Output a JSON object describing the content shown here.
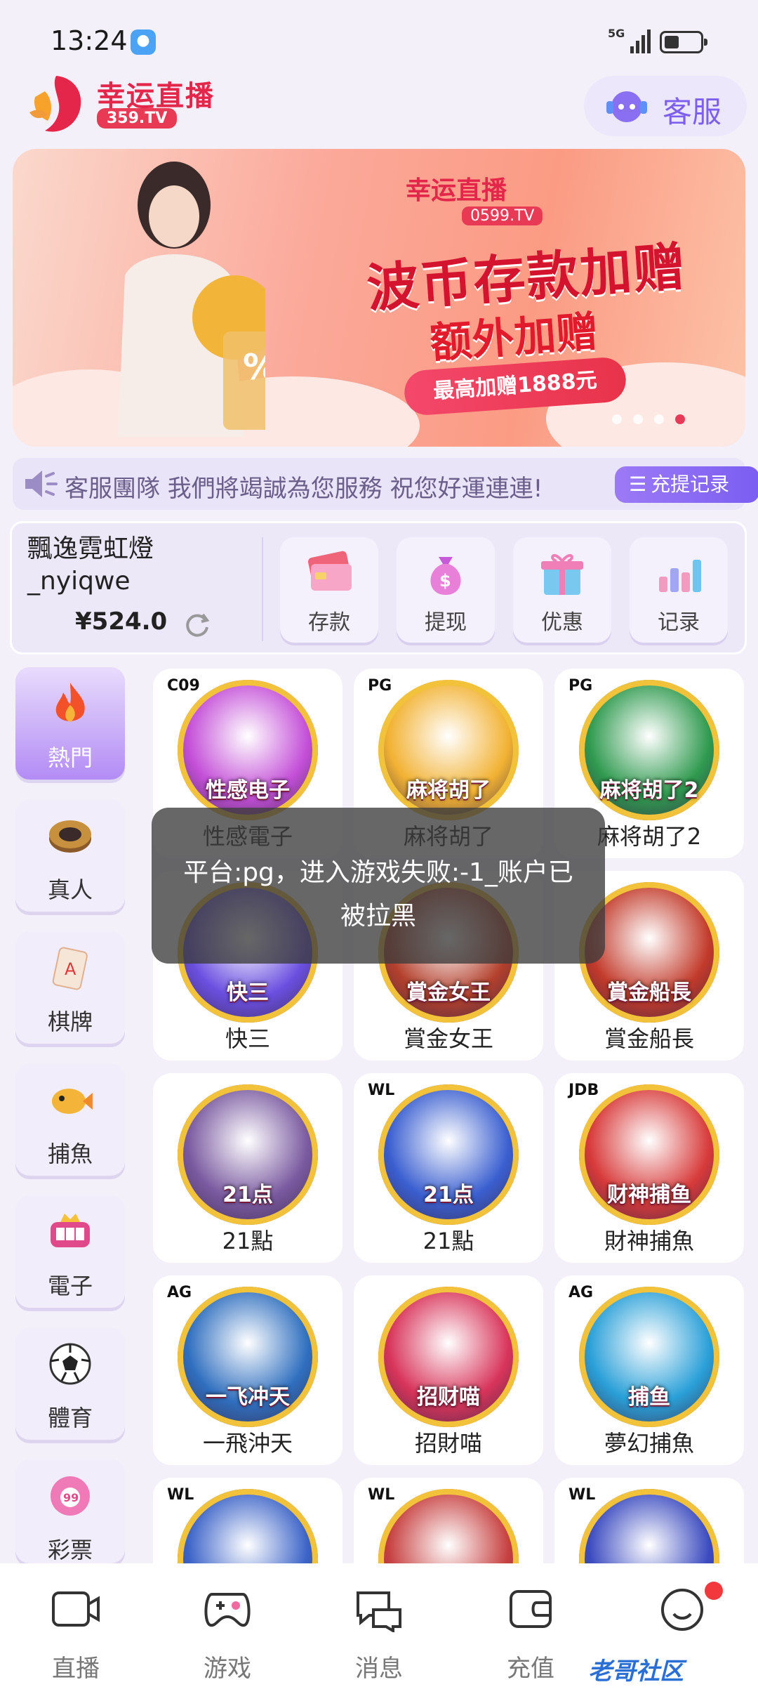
{
  "status_bar": {
    "time": "13:24",
    "network": "5G"
  },
  "header": {
    "app_name": "幸运直播",
    "domain": "359.TV",
    "service_label": "客服"
  },
  "banner": {
    "brand": "幸运直播",
    "brand_domain": "0599.TV",
    "headline": "波币存款加赠",
    "subline": "额外加赠",
    "pill": "最高加赠1888元",
    "badge_text": "%",
    "slide_count": 4,
    "active_slide": 4
  },
  "notice": {
    "text": "客服團隊 我們將竭誠為您服務 祝您好運連連!",
    "record_button": "充提记录"
  },
  "account": {
    "username": "飄逸霓虹燈_nyiqwe",
    "balance": "¥524.0",
    "actions": [
      {
        "label": "存款",
        "icon": "card-icon"
      },
      {
        "label": "提现",
        "icon": "money-bag-icon"
      },
      {
        "label": "优惠",
        "icon": "gift-icon"
      },
      {
        "label": "记录",
        "icon": "bar-chart-icon"
      }
    ]
  },
  "categories": [
    {
      "label": "熱門",
      "icon": "flame-icon",
      "active": true
    },
    {
      "label": "真人",
      "icon": "chip-icon",
      "active": false
    },
    {
      "label": "棋牌",
      "icon": "playing-card-icon",
      "active": false
    },
    {
      "label": "捕魚",
      "icon": "fish-icon",
      "active": false
    },
    {
      "label": "電子",
      "icon": "slot-machine-icon",
      "active": false
    },
    {
      "label": "體育",
      "icon": "soccer-ball-icon",
      "active": false
    },
    {
      "label": "彩票",
      "icon": "lottery-ball-icon",
      "active": false
    }
  ],
  "games": [
    {
      "title": "性感電子",
      "provider": "C09",
      "art_text": "性感电子",
      "color": "#c44fd8"
    },
    {
      "title": "麻将胡了",
      "provider": "PG",
      "art_text": "麻将胡了",
      "color": "#f2b233"
    },
    {
      "title": "麻将胡了2",
      "provider": "PG",
      "art_text": "麻将胡了2",
      "color": "#2f9a4f"
    },
    {
      "title": "快三",
      "provider": "",
      "art_text": "快三",
      "color": "#6a4fe0"
    },
    {
      "title": "賞金女王",
      "provider": "",
      "art_text": "賞金女王",
      "color": "#b3402c"
    },
    {
      "title": "賞金船長",
      "provider": "",
      "art_text": "賞金船長",
      "color": "#c23a2a"
    },
    {
      "title": "21點",
      "provider": "",
      "art_text": "21点",
      "color": "#7a5aa0"
    },
    {
      "title": "21點",
      "provider": "WL",
      "art_text": "21点",
      "color": "#3a5fd0"
    },
    {
      "title": "財神捕魚",
      "provider": "JDB",
      "art_text": "财神捕鱼",
      "color": "#d83a3a"
    },
    {
      "title": "一飛沖天",
      "provider": "AG",
      "art_text": "一飞冲天",
      "color": "#2f6fbf"
    },
    {
      "title": "招財喵",
      "provider": "",
      "art_text": "招财喵",
      "color": "#d8345a"
    },
    {
      "title": "夢幻捕魚",
      "provider": "AG",
      "art_text": "捕鱼",
      "color": "#2aa0d8"
    },
    {
      "title": "",
      "provider": "WL",
      "art_text": "",
      "color": "#3b63c7"
    },
    {
      "title": "",
      "provider": "WL",
      "art_text": "",
      "color": "#c74040"
    },
    {
      "title": "",
      "provider": "WL",
      "art_text": "",
      "color": "#3b4bbf"
    }
  ],
  "toast": {
    "message": "平台:pg，进入游戏失败:-1_账户已被拉黑"
  },
  "bottom_nav": [
    {
      "label": "直播",
      "icon": "video-camera-icon"
    },
    {
      "label": "游戏",
      "icon": "gamepad-icon"
    },
    {
      "label": "消息",
      "icon": "chat-bubbles-icon"
    },
    {
      "label": "充值",
      "icon": "wallet-icon"
    },
    {
      "label": "",
      "icon": "smiley-icon",
      "has_badge": true
    }
  ],
  "watermark": "老哥社区",
  "colors": {
    "accent": "#7d5ff0",
    "brand_red": "#e3264a",
    "page_bg": "#f3f0fa"
  }
}
